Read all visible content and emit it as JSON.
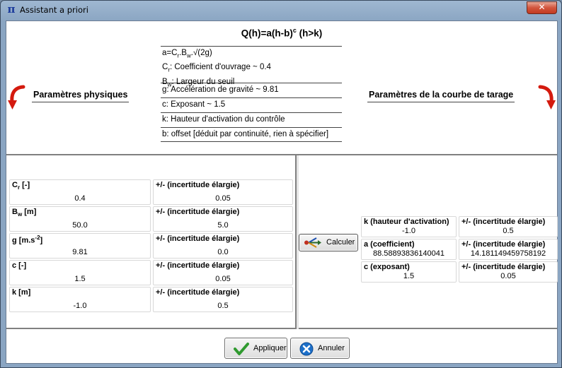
{
  "window": {
    "title": "Assistant a priori",
    "icon": "pi-icon",
    "close_label": "✕"
  },
  "header": {
    "formula_main": "Q(h)=a(h-b)",
    "formula_exp": "c",
    "formula_cond": " (h>k)",
    "left_label": "Paramètres physiques",
    "right_label": "Paramètres de la courbe de tarage",
    "defs": {
      "a_pre": "a=C",
      "a_sub1": "r",
      "a_mid": ".B",
      "a_sub2": "w",
      "a_post": ".√(2g)",
      "cr_pre": "C",
      "cr_sub": "r",
      "cr_post": ": Coefficient d'ouvrage ~ 0.4",
      "bw_pre": "B",
      "bw_sub": "w",
      "bw_post": ": Largeur du seuil",
      "g": "g: Accélération de gravité ~ 9.81",
      "c": "c: Exposant ~ 1.5",
      "k": "k: Hauteur d'activation du contrôle",
      "b": "b: offset [déduit par continuité, rien à spécifier]"
    }
  },
  "physical": {
    "uncertainty_label": "+/- (incertitude élargie)",
    "rows": [
      {
        "label_pre": "C",
        "label_sub": "r",
        "label_post": " [-]",
        "label_sup": "",
        "value": "0.4",
        "uncertainty": "0.05"
      },
      {
        "label_pre": "B",
        "label_sub": "w",
        "label_post": " [m]",
        "label_sup": "",
        "value": "50.0",
        "uncertainty": "5.0"
      },
      {
        "label_pre": "g [m.s",
        "label_sub": "",
        "label_post": "]",
        "label_sup": "-2",
        "value": "9.81",
        "uncertainty": "0.0"
      },
      {
        "label_pre": "c [-]",
        "label_sub": "",
        "label_post": "",
        "label_sup": "",
        "value": "1.5",
        "uncertainty": "0.05"
      },
      {
        "label_pre": "k [m]",
        "label_sub": "",
        "label_post": "",
        "label_sup": "",
        "value": "-1.0",
        "uncertainty": "0.5"
      }
    ]
  },
  "calculate_button": "Calculer",
  "results": {
    "uncertainty_label": "+/- (incertitude élargie)",
    "rows": [
      {
        "label": "k (hauteur d'activation)",
        "value": "-1.0",
        "uncertainty": "0.5"
      },
      {
        "label": "a (coefficient)",
        "value": "88.58893836140041",
        "uncertainty": "14.181149459758192"
      },
      {
        "label": "c (exposant)",
        "value": "1.5",
        "uncertainty": "0.05"
      }
    ]
  },
  "footer": {
    "apply_label": "Appliquer",
    "cancel_label": "Annuler"
  },
  "colors": {
    "arrow_red": "#d41a0e",
    "titlebar": "#8aa5c2",
    "close_red": "#c23a20"
  }
}
